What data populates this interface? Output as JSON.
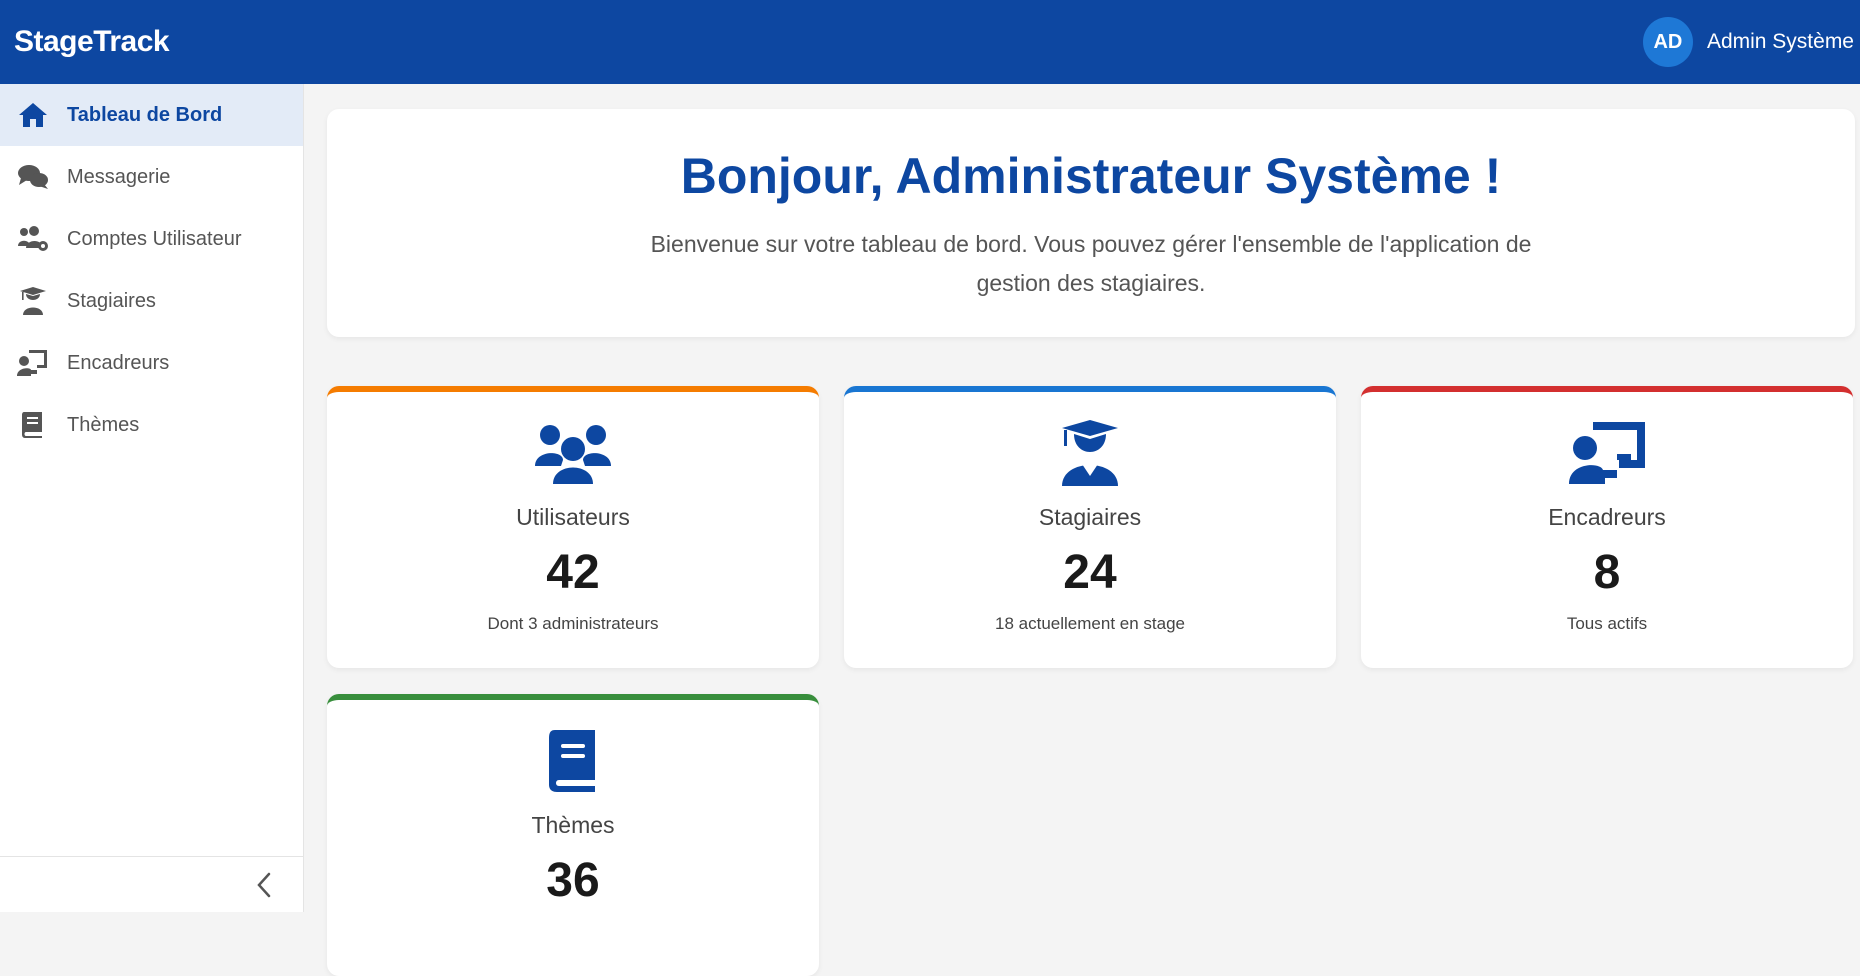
{
  "header": {
    "brand": "StageTrack",
    "user_initials": "AD",
    "user_name": "Admin Système",
    "color": "#0d47a1"
  },
  "sidebar": {
    "items": [
      {
        "label": "Tableau de Bord",
        "icon": "home-icon",
        "active": true
      },
      {
        "label": "Messagerie",
        "icon": "comments-icon",
        "active": false
      },
      {
        "label": "Comptes Utilisateur",
        "icon": "users-cog-icon",
        "active": false
      },
      {
        "label": "Stagiaires",
        "icon": "graduate-icon",
        "active": false
      },
      {
        "label": "Encadreurs",
        "icon": "chalkboard-teacher-icon",
        "active": false
      },
      {
        "label": "Thèmes",
        "icon": "book-icon",
        "active": false
      }
    ],
    "collapse_icon": "chevron-left-icon"
  },
  "welcome": {
    "title": "Bonjour, Administrateur Système !",
    "text": "Bienvenue sur votre tableau de bord. Vous pouvez gérer l'ensemble de l'application de gestion des stagiaires."
  },
  "stats": [
    {
      "label": "Utilisateurs",
      "value": "42",
      "note": "Dont 3 administrateurs",
      "icon": "users-icon",
      "accent": "#f57c00"
    },
    {
      "label": "Stagiaires",
      "value": "24",
      "note": "18 actuellement en stage",
      "icon": "graduate-icon",
      "accent": "#1976d2"
    },
    {
      "label": "Encadreurs",
      "value": "8",
      "note": "Tous actifs",
      "icon": "chalkboard-teacher-icon",
      "accent": "#d32f2f"
    },
    {
      "label": "Thèmes",
      "value": "36",
      "note": "",
      "icon": "book-icon",
      "accent": "#388e3c"
    }
  ]
}
